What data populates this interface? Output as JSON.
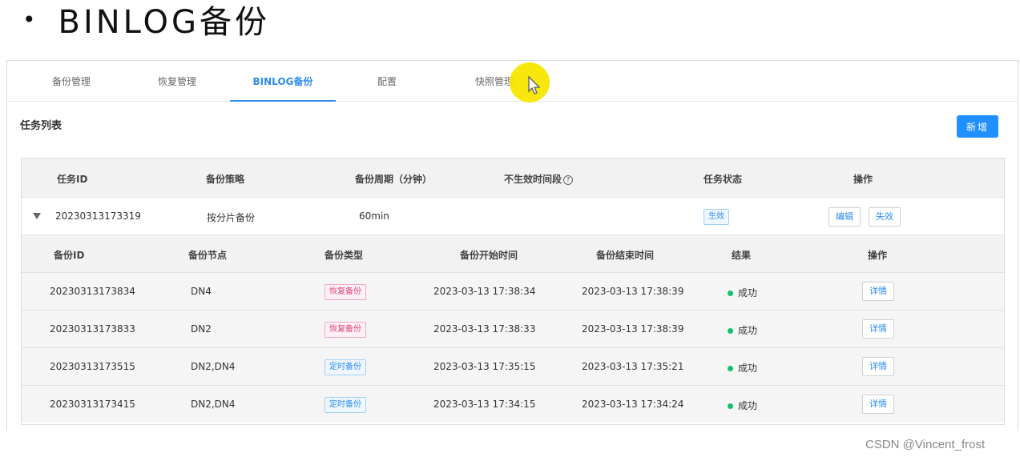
{
  "slide": {
    "bullet": "•",
    "title": "BINLOG备份"
  },
  "tabs": [
    "备份管理",
    "恢复管理",
    "BINLOG备份",
    "配置",
    "快照管理"
  ],
  "active_tab": "BINLOG备份",
  "list_title": "任务列表",
  "add_button": "新增",
  "task_table": {
    "headers": [
      "任务ID",
      "备份策略",
      "备份周期（分钟）",
      "不生效时间段",
      "任务状态",
      "操作"
    ],
    "help_icon": "?",
    "row": {
      "id": "20230313173319",
      "strategy": "按分片备份",
      "period": "60min",
      "status": "生效",
      "actions": [
        "编辑",
        "失效"
      ]
    }
  },
  "backup_table": {
    "headers": [
      "备份ID",
      "备份节点",
      "备份类型",
      "备份开始时间",
      "备份结束时间",
      "结果",
      "操作"
    ],
    "rows": [
      {
        "id": "20230313173834",
        "nodes": "DN4",
        "type": "恢复备份",
        "start": "2023-03-13 17:38:34",
        "end": "2023-03-13 17:38:39",
        "result": "成功",
        "action": "详情"
      },
      {
        "id": "20230313173833",
        "nodes": "DN2",
        "type": "恢复备份",
        "start": "2023-03-13 17:38:33",
        "end": "2023-03-13 17:38:39",
        "result": "成功",
        "action": "详情"
      },
      {
        "id": "20230313173515",
        "nodes": "DN2,DN4",
        "type": "定时备份",
        "start": "2023-03-13 17:35:15",
        "end": "2023-03-13 17:35:21",
        "result": "成功",
        "action": "详情"
      },
      {
        "id": "20230313173415",
        "nodes": "DN2,DN4",
        "type": "定时备份",
        "start": "2023-03-13 17:34:15",
        "end": "2023-03-13 17:34:24",
        "result": "成功",
        "action": "详情"
      }
    ]
  },
  "watermark": "CSDN @Vincent_frost",
  "colors": {
    "accent": "#2d8cf0",
    "button": "#1e90ff",
    "success": "#19be6b",
    "restore_tag": "#e0437a"
  }
}
